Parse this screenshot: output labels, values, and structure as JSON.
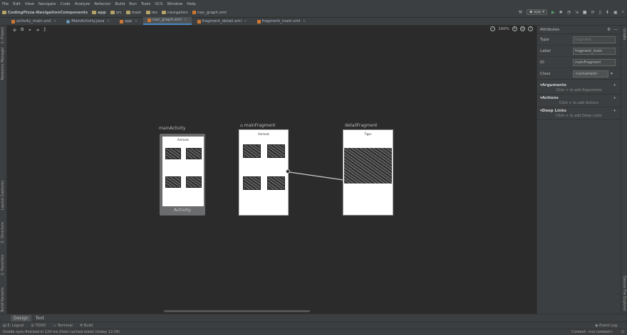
{
  "menu": [
    "File",
    "Edit",
    "View",
    "Navigate",
    "Code",
    "Analyze",
    "Refactor",
    "Build",
    "Run",
    "Tools",
    "VCS",
    "Window",
    "Help"
  ],
  "breadcrumbs": [
    "CodingPizza-NavigationComponents",
    "app",
    "src",
    "main",
    "res",
    "navigation",
    "nav_graph.xml"
  ],
  "run_config": "app",
  "tabs": [
    {
      "label": "activity_main.xml",
      "kind": "xml",
      "active": false
    },
    {
      "label": "MainActivity.java",
      "kind": "java",
      "active": false
    },
    {
      "label": "app",
      "kind": "xml",
      "active": false
    },
    {
      "label": "nav_graph.xml",
      "kind": "xml",
      "active": true
    },
    {
      "label": "fragment_detail.xml",
      "kind": "xml",
      "active": false
    },
    {
      "label": "fragment_main.xml",
      "kind": "xml",
      "active": false
    }
  ],
  "left_strip": [
    "1: Project",
    "Resource Manager",
    "Layout Captures",
    "Z: Structure",
    "2: Favorites",
    "Build Variants"
  ],
  "right_strip": [
    "Gradle",
    "Device File Explorer"
  ],
  "zoom": "100%",
  "canvas": {
    "activity": {
      "label": "mainActivity",
      "title": "Animals",
      "footer": "Activity"
    },
    "main_fragment": {
      "label": "mainFragment",
      "title": "Animals"
    },
    "detail_fragment": {
      "label": "detailFragment",
      "title": "Tiger"
    }
  },
  "attributes": {
    "title": "Attributes",
    "rows": [
      {
        "label": "Type",
        "value": "fragment",
        "placeholder": true
      },
      {
        "label": "Label",
        "value": "fragment_main",
        "placeholder": false
      },
      {
        "label": "ID",
        "value": "mainFragment",
        "placeholder": false
      },
      {
        "label": "Class",
        "value": "<unnamed>",
        "placeholder": false
      }
    ],
    "sections": [
      {
        "title": "Arguments",
        "hint": "Click + to add Arguments"
      },
      {
        "title": "Actions",
        "hint": "Click + to add Actions"
      },
      {
        "title": "Deep Links",
        "hint": "Click + to add Deep Links"
      }
    ]
  },
  "bottom_tabs": [
    "Design",
    "Text"
  ],
  "tool_windows": [
    "6: Logcat",
    "TODO",
    "Terminal",
    "Build"
  ],
  "event_log": "Event Log",
  "status_text": "Gradle sync finished in 124 ms (from cached state) (today 12:34)",
  "context_text": "Context: <no context>",
  "colors": {
    "accent": "#4a88c7",
    "background": "#2b2b2b",
    "panel": "#3c3f41"
  }
}
